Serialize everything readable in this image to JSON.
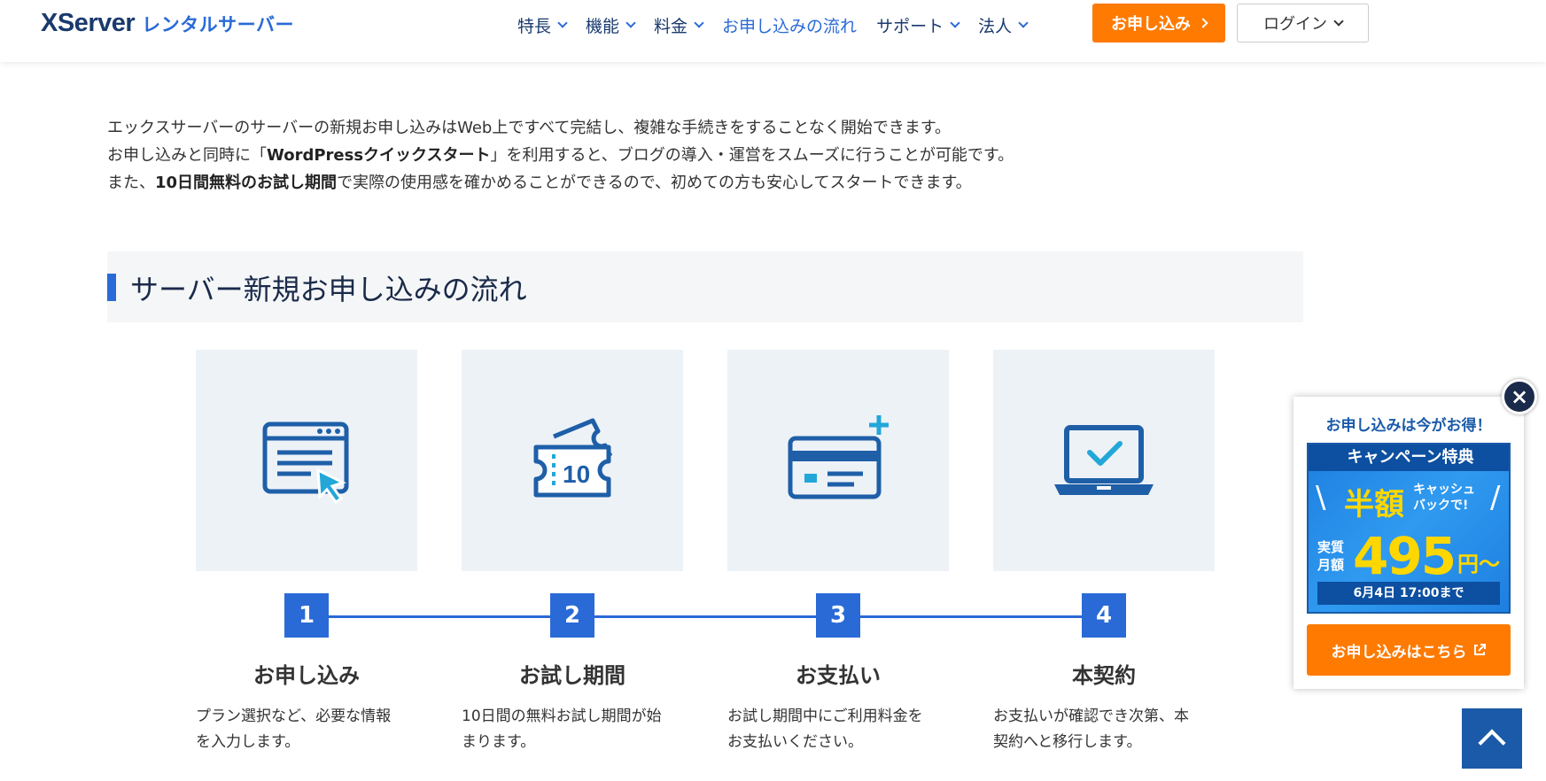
{
  "header": {
    "logo_main": "XServer",
    "logo_sub": "レンタルサーバー",
    "nav": [
      {
        "label": "特長",
        "has_dropdown": true,
        "active": false
      },
      {
        "label": "機能",
        "has_dropdown": true,
        "active": false
      },
      {
        "label": "料金",
        "has_dropdown": true,
        "active": false
      },
      {
        "label": "お申し込みの流れ",
        "has_dropdown": false,
        "active": true
      },
      {
        "label": "サポート",
        "has_dropdown": true,
        "active": false
      },
      {
        "label": "法人",
        "has_dropdown": true,
        "active": false
      }
    ],
    "apply_label": "お申し込み",
    "login_label": "ログイン"
  },
  "intro": {
    "line1": "エックスサーバーのサーバーの新規お申し込みはWeb上ですべて完結し、複雑な手続きをすることなく開始できます。",
    "line2_pre": "お申し込みと同時に「",
    "line2_bold": "WordPressクイックスタート",
    "line2_post": "」を利用すると、ブログの導入・運営をスムーズに行うことが可能です。",
    "line3_pre": "また、",
    "line3_bold": "10日間無料のお試し期間",
    "line3_post": "で実際の使用感を確かめることができるので、初めての方も安心してスタートできます。"
  },
  "section": {
    "title": "サーバー新規お申し込みの流れ"
  },
  "steps": [
    {
      "number": "1",
      "title": "お申し込み",
      "desc_line1": "プラン選択など、必要な情報",
      "desc_line2": "を入力します。",
      "icon": "web-form-cursor-icon"
    },
    {
      "number": "2",
      "title": "お試し期間",
      "desc_line1": "10日間の無料お試し期間が始",
      "desc_line2": "まります。",
      "icon": "ticket-10-icon",
      "ticket_text": "10"
    },
    {
      "number": "3",
      "title": "お支払い",
      "desc_line1": "お試し期間中にご利用料金を",
      "desc_line2": "お支払いください。",
      "icon": "credit-card-plus-icon"
    },
    {
      "number": "4",
      "title": "本契約",
      "desc_line1": "お支払いが確認でき次第、本",
      "desc_line2": "契約へと移行します。",
      "icon": "laptop-check-icon"
    }
  ],
  "popup": {
    "heading": "お申し込みは今がお得！",
    "banner_title": "キャンペーン特典",
    "banner_half": "半額",
    "banner_cash1": "キャッシュ",
    "banner_cash2": "バックで!",
    "banner_monthly1": "実質",
    "banner_monthly2": "月額",
    "banner_price": "495",
    "banner_yen": "円〜",
    "banner_deadline": "6月4日 17:00まで",
    "button_label": "お申し込みはこちら",
    "close_label": "×"
  },
  "colors": {
    "brand_blue": "#2a6ad6",
    "navy": "#1a3a6e",
    "orange": "#ff7a00",
    "card_bg": "#edf2f7",
    "icon_blue": "#1e5fa8",
    "accent_cyan": "#22a7d8"
  }
}
